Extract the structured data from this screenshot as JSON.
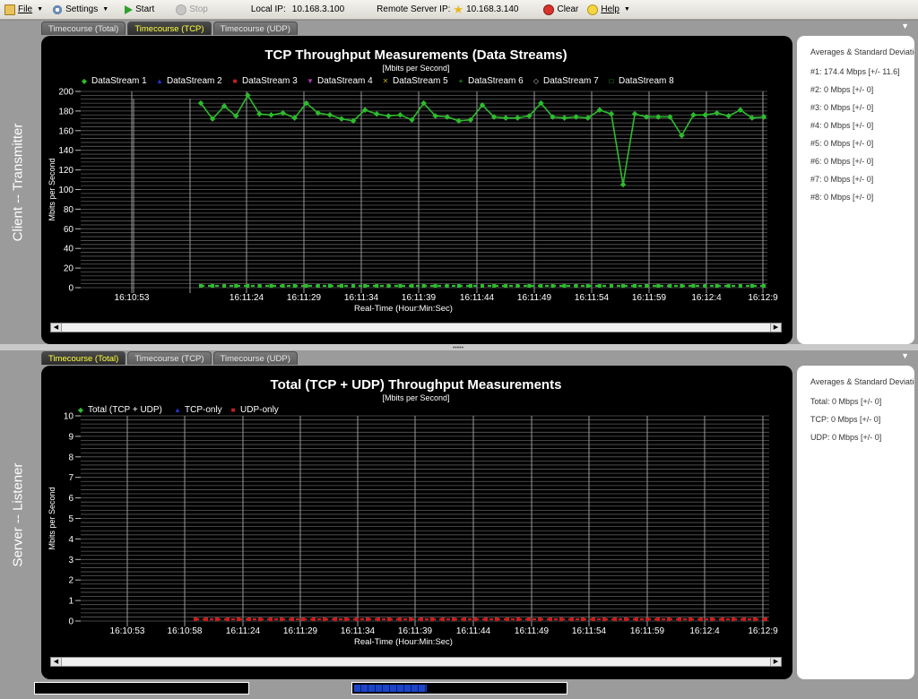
{
  "toolbar": {
    "file": "File",
    "settings": "Settings",
    "start": "Start",
    "stop": "Stop",
    "local_ip_label": "Local IP:",
    "local_ip": "10.168.3.100",
    "remote_ip_label": "Remote Server IP:",
    "remote_ip": "10.168.3.140",
    "clear": "Clear",
    "help": "Help"
  },
  "top_panel": {
    "side_label": "Client -- Transmitter",
    "tabs": [
      "Timecourse (Total)",
      "Timecourse (TCP)",
      "Timecourse (UDP)"
    ],
    "active_tab": 1,
    "stats": {
      "title": "Averages & Standard Deviations",
      "rows": [
        "#1: 174.4 Mbps [+/-  11.6]",
        "#2: 0 Mbps [+/-  0]",
        "#3: 0 Mbps [+/-  0]",
        "#4: 0 Mbps [+/-  0]",
        "#5: 0 Mbps [+/-  0]",
        "#6: 0 Mbps [+/-  0]",
        "#7: 0 Mbps [+/-  0]",
        "#8: 0 Mbps [+/-  0]"
      ]
    }
  },
  "bottom_panel": {
    "side_label": "Server -- Listener",
    "tabs": [
      "Timecourse (Total)",
      "Timecourse (TCP)",
      "Timecourse (UDP)"
    ],
    "active_tab": 0,
    "stats": {
      "title": "Averages & Standard Deviations",
      "rows": [
        "Total: 0 Mbps [+/-  0]",
        "TCP:   0 Mbps [+/-  0]",
        "UDP:   0 Mbps [+/-  0]"
      ]
    }
  },
  "colors": {
    "accent_tab": "#ffff3c",
    "series_green": "#2dbb2d",
    "series_red": "#c81e1e",
    "series_blue": "#2233cc"
  },
  "status": {
    "progress": 0.34
  },
  "chart_data": [
    {
      "type": "line",
      "title": "TCP Throughput Measurements (Data Streams)",
      "subtitle": "[Mbits per Second]",
      "xlabel": "Real-Time (Hour:Min:Sec)",
      "ylabel": "Mbits per Second",
      "ylim": [
        0,
        200
      ],
      "yticks": [
        0,
        20,
        40,
        60,
        80,
        100,
        120,
        140,
        160,
        180,
        200
      ],
      "xticks": [
        "16:10:53",
        "16:11:24",
        "16:11:29",
        "16:11:34",
        "16:11:39",
        "16:11:44",
        "16:11:49",
        "16:11:54",
        "16:11:59",
        "16:12:4",
        "16:12:9"
      ],
      "legend": "top",
      "grid": true,
      "series": [
        {
          "name": "DataStream 1",
          "marker": "◆",
          "color": "#2dbb2d",
          "values": [
            188,
            172,
            185,
            175,
            196,
            177,
            176,
            178,
            173,
            188,
            178,
            176,
            172,
            170,
            181,
            177,
            175,
            176,
            171,
            188,
            175,
            174,
            170,
            171,
            186,
            174,
            173,
            173,
            175,
            188,
            174,
            173,
            174,
            173,
            181,
            177,
            105,
            177,
            174,
            174,
            174,
            155,
            176,
            176,
            178,
            175,
            181,
            173,
            174
          ]
        },
        {
          "name": "DataStream 2",
          "marker": "▲",
          "color": "#2233cc",
          "values": []
        },
        {
          "name": "DataStream 3",
          "marker": "■",
          "color": "#c81e1e",
          "values": []
        },
        {
          "name": "DataStream 4",
          "marker": "▼",
          "color": "#b23ab2",
          "values": []
        },
        {
          "name": "DataStream 5",
          "marker": "✕",
          "color": "#b4a030",
          "values": []
        },
        {
          "name": "DataStream 6",
          "marker": "+",
          "color": "#2dbb2d",
          "values": []
        },
        {
          "name": "DataStream 7",
          "marker": "◇",
          "color": "#c8c8c8",
          "values": []
        },
        {
          "name": "DataStream 8",
          "marker": "□",
          "color": "#2dbb2d",
          "values": [
            0,
            0,
            0,
            0,
            0,
            0,
            0,
            0,
            0,
            0,
            0,
            0,
            0,
            0,
            0,
            0,
            0,
            0,
            0,
            0,
            0,
            0,
            0,
            0,
            0,
            0,
            0,
            0,
            0,
            0,
            0,
            0,
            0,
            0,
            0,
            0,
            0,
            0,
            0,
            0,
            0,
            0,
            0,
            0,
            0,
            0,
            0,
            0,
            0
          ]
        }
      ]
    },
    {
      "type": "line",
      "title": "Total (TCP + UDP) Throughput Measurements",
      "subtitle": "[Mbits per Second]",
      "xlabel": "Real-Time (Hour:Min:Sec)",
      "ylabel": "Mbits per Second",
      "ylim": [
        0,
        10
      ],
      "yticks": [
        0,
        1,
        2,
        3,
        4,
        5,
        6,
        7,
        8,
        9,
        10
      ],
      "xticks": [
        "16:10:53",
        "16:10:58",
        "16:11:24",
        "16:11:29",
        "16:11:34",
        "16:11:39",
        "16:11:44",
        "16:11:49",
        "16:11:54",
        "16:11:59",
        "16:12:4",
        "16:12:9"
      ],
      "legend": "top",
      "grid": true,
      "series": [
        {
          "name": "Total (TCP + UDP)",
          "marker": "◆",
          "color": "#2dbb2d",
          "values": []
        },
        {
          "name": "TCP-only",
          "marker": "▲",
          "color": "#2233cc",
          "values": []
        },
        {
          "name": "UDP-only",
          "marker": "■",
          "color": "#c81e1e",
          "values": [
            0,
            0,
            0,
            0,
            0,
            0,
            0,
            0,
            0,
            0,
            0,
            0,
            0,
            0,
            0,
            0,
            0,
            0,
            0,
            0,
            0,
            0,
            0,
            0,
            0,
            0,
            0,
            0,
            0,
            0,
            0,
            0,
            0,
            0,
            0,
            0,
            0,
            0,
            0,
            0,
            0,
            0,
            0,
            0,
            0,
            0,
            0,
            0,
            0,
            0,
            0,
            0,
            0,
            0
          ]
        }
      ]
    }
  ]
}
